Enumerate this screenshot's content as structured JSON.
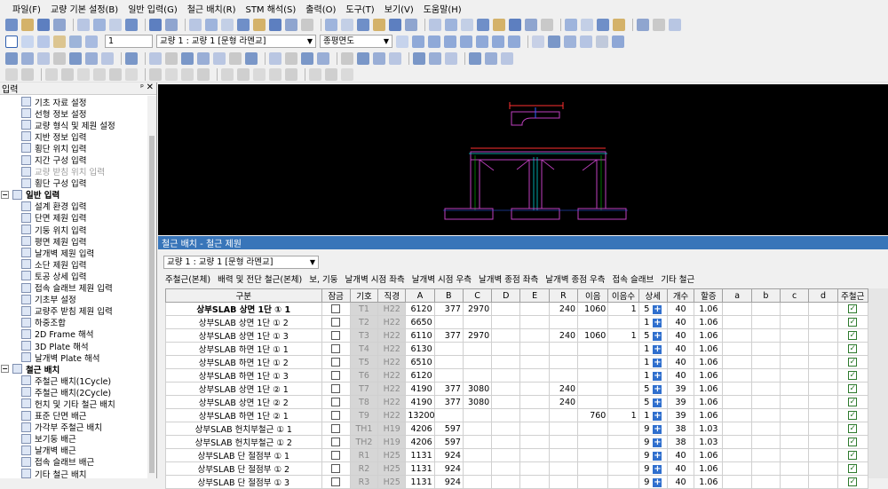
{
  "menu": [
    "파일(F)",
    "교량 기본 설정(B)",
    "일반 입력(G)",
    "철근 배치(R)",
    "STM 해석(S)",
    "출력(O)",
    "도구(T)",
    "보기(V)",
    "도움말(H)"
  ],
  "toolbar2": {
    "step_value": "1",
    "bridge_combo": "교량 1 : 교량 1 [문형 라멘교]",
    "view_combo": "종평면도"
  },
  "left_panel": {
    "title": "입력",
    "items": [
      {
        "label": "기초 자료 설정",
        "type": "child"
      },
      {
        "label": "선형 정보 설정",
        "type": "child"
      },
      {
        "label": "교량 형식 및 제원 설정",
        "type": "child"
      },
      {
        "label": "지반 정보 입력",
        "type": "child"
      },
      {
        "label": "횡단 위치 입력",
        "type": "child"
      },
      {
        "label": "지간 구성 입력",
        "type": "child"
      },
      {
        "label": "교량 받침 위치 입력",
        "type": "disabled"
      },
      {
        "label": "횡단 구성 입력",
        "type": "child"
      },
      {
        "label": "일반 입력",
        "type": "group"
      },
      {
        "label": "설계 환경 입력",
        "type": "child"
      },
      {
        "label": "단면 제원 입력",
        "type": "child"
      },
      {
        "label": "기둥 위치 입력",
        "type": "child"
      },
      {
        "label": "평면 제원 입력",
        "type": "child"
      },
      {
        "label": "날개벽 제원 입력",
        "type": "child"
      },
      {
        "label": "소단 제원 입력",
        "type": "child"
      },
      {
        "label": "토공 상세 입력",
        "type": "child"
      },
      {
        "label": "접속 슬래브 제원 입력",
        "type": "child"
      },
      {
        "label": "기초부 설정",
        "type": "child"
      },
      {
        "label": "교량주 받침 제원 입력",
        "type": "child"
      },
      {
        "label": "하중조합",
        "type": "child"
      },
      {
        "label": "2D Frame 해석",
        "type": "child"
      },
      {
        "label": "3D Plate 해석",
        "type": "child"
      },
      {
        "label": "날개벽 Plate 해석",
        "type": "child"
      },
      {
        "label": "철근 배치",
        "type": "group"
      },
      {
        "label": "주철근 배치(1Cycle)",
        "type": "child"
      },
      {
        "label": "주철근 배치(2Cycle)",
        "type": "child"
      },
      {
        "label": "헌치 및 기타 철근 배치",
        "type": "child"
      },
      {
        "label": "표준 단면 배근",
        "type": "child"
      },
      {
        "label": "가각부 주철근 배치",
        "type": "child"
      },
      {
        "label": "보기둥 배근",
        "type": "child"
      },
      {
        "label": "날개벽 배근",
        "type": "child"
      },
      {
        "label": "접속 슬래브 배근",
        "type": "child"
      },
      {
        "label": "기타 철근 배치",
        "type": "child"
      }
    ]
  },
  "subwindow": {
    "title": "철근 배치 - 철근 제원",
    "bridge_select": "교량 1 : 교량 1 [문형 라멘교]",
    "tabs": [
      "주철근(본체)",
      "배력 및 전단 철근(본체)",
      "보, 기둥",
      "날개벽 시점 좌측",
      "날개벽 시점 우측",
      "날개벽 종점 좌측",
      "날개벽 종점 우측",
      "접속 슬래브",
      "기타 철근"
    ],
    "columns": [
      "구분",
      "잠금",
      "기호",
      "직경",
      "A",
      "B",
      "C",
      "D",
      "E",
      "R",
      "이음",
      "이음수",
      "상세",
      "개수",
      "할증",
      "a",
      "b",
      "c",
      "d",
      "주철근"
    ],
    "rows": [
      [
        "상부SLAB 상면 1단 ① 1",
        "",
        "T1",
        "H22",
        "6120",
        "377",
        "2970",
        "",
        "",
        "240",
        "1060",
        "1",
        "5",
        "40",
        "1.06"
      ],
      [
        "상부SLAB 상면 1단 ① 2",
        "",
        "T2",
        "H22",
        "6650",
        "",
        "",
        "",
        "",
        "",
        "",
        "",
        "1",
        "40",
        "1.06"
      ],
      [
        "상부SLAB 상면 1단 ① 3",
        "",
        "T3",
        "H22",
        "6110",
        "377",
        "2970",
        "",
        "",
        "240",
        "1060",
        "1",
        "5",
        "40",
        "1.06"
      ],
      [
        "상부SLAB 하면 1단 ① 1",
        "",
        "T4",
        "H22",
        "6130",
        "",
        "",
        "",
        "",
        "",
        "",
        "",
        "1",
        "40",
        "1.06"
      ],
      [
        "상부SLAB 하면 1단 ① 2",
        "",
        "T5",
        "H22",
        "6510",
        "",
        "",
        "",
        "",
        "",
        "",
        "",
        "1",
        "40",
        "1.06"
      ],
      [
        "상부SLAB 하면 1단 ① 3",
        "",
        "T6",
        "H22",
        "6120",
        "",
        "",
        "",
        "",
        "",
        "",
        "",
        "1",
        "40",
        "1.06"
      ],
      [
        "상부SLAB 상면 1단 ② 1",
        "",
        "T7",
        "H22",
        "4190",
        "377",
        "3080",
        "",
        "",
        "240",
        "",
        "",
        "5",
        "39",
        "1.06"
      ],
      [
        "상부SLAB 상면 1단 ② 2",
        "",
        "T8",
        "H22",
        "4190",
        "377",
        "3080",
        "",
        "",
        "240",
        "",
        "",
        "5",
        "39",
        "1.06"
      ],
      [
        "상부SLAB 하면 1단 ② 1",
        "",
        "T9",
        "H22",
        "13200",
        "",
        "",
        "",
        "",
        "",
        "760",
        "1",
        "1",
        "39",
        "1.06"
      ],
      [
        "상부SLAB 헌치부철근 ① 1",
        "",
        "TH1",
        "H19",
        "4206",
        "597",
        "",
        "",
        "",
        "",
        "",
        "",
        "9",
        "38",
        "1.03"
      ],
      [
        "상부SLAB 헌치부철근 ① 2",
        "",
        "TH2",
        "H19",
        "4206",
        "597",
        "",
        "",
        "",
        "",
        "",
        "",
        "9",
        "38",
        "1.03"
      ],
      [
        "상부SLAB 단 절점부 ① 1",
        "",
        "R1",
        "H25",
        "1131",
        "924",
        "",
        "",
        "",
        "",
        "",
        "",
        "9",
        "40",
        "1.06"
      ],
      [
        "상부SLAB 단 절점부 ① 2",
        "",
        "R2",
        "H25",
        "1131",
        "924",
        "",
        "",
        "",
        "",
        "",
        "",
        "9",
        "40",
        "1.06"
      ],
      [
        "상부SLAB 단 절점부 ① 3",
        "",
        "R3",
        "H25",
        "1131",
        "924",
        "",
        "",
        "",
        "",
        "",
        "",
        "9",
        "40",
        "1.06"
      ]
    ]
  }
}
